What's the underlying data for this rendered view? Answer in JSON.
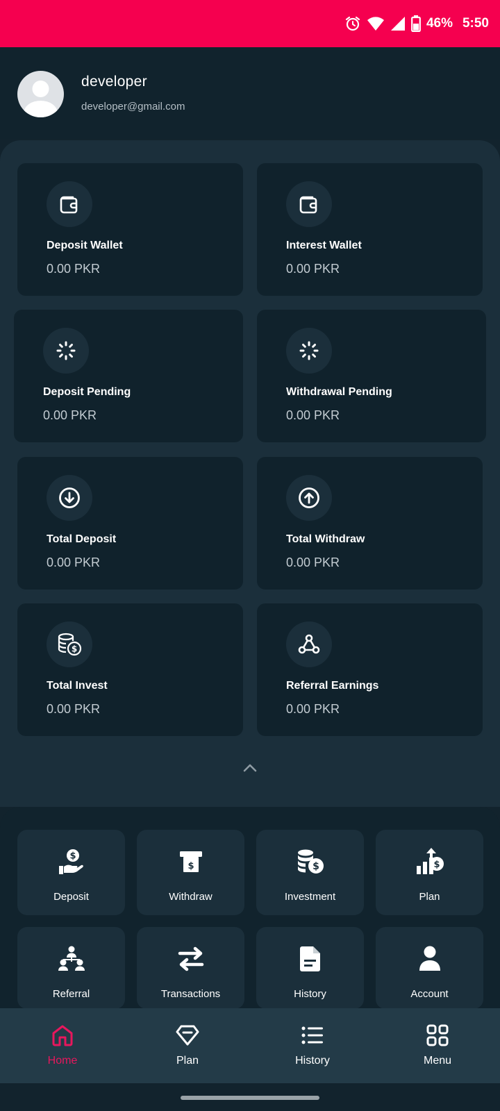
{
  "status_bar": {
    "battery": "46%",
    "time": "5:50",
    "icons": [
      "alarm-icon",
      "wifi-icon",
      "signal-icon",
      "battery-icon"
    ]
  },
  "profile": {
    "name": "developer",
    "email": "developer@gmail.com",
    "avatar_icon": "user-avatar-icon"
  },
  "stats": [
    {
      "title": "Deposit Wallet",
      "value": "0.00 PKR",
      "icon": "wallet-icon"
    },
    {
      "title": "Interest Wallet",
      "value": "0.00 PKR",
      "icon": "wallet-icon"
    },
    {
      "title": "Deposit Pending",
      "value": "0.00 PKR",
      "icon": "spinner-icon"
    },
    {
      "title": "Withdrawal Pending",
      "value": "0.00 PKR",
      "icon": "spinner-icon"
    },
    {
      "title": "Total Deposit",
      "value": "0.00 PKR",
      "icon": "arrow-down-circle-icon"
    },
    {
      "title": "Total Withdraw",
      "value": "0.00 PKR",
      "icon": "arrow-up-circle-icon"
    },
    {
      "title": "Total Invest",
      "value": "0.00 PKR",
      "icon": "coins-dollar-icon"
    },
    {
      "title": "Referral Earnings",
      "value": "0.00 PKR",
      "icon": "network-icon"
    }
  ],
  "menu": [
    {
      "label": "Deposit",
      "icon": "hand-dollar-icon"
    },
    {
      "label": "Withdraw",
      "icon": "atm-icon"
    },
    {
      "label": "Investment",
      "icon": "coins-dollar-icon"
    },
    {
      "label": "Plan",
      "icon": "growth-chart-icon"
    },
    {
      "label": "Referral",
      "icon": "team-icon"
    },
    {
      "label": "Transactions",
      "icon": "exchange-icon"
    },
    {
      "label": "History",
      "icon": "document-icon"
    },
    {
      "label": "Account",
      "icon": "user-icon"
    }
  ],
  "bottom_nav": [
    {
      "label": "Home",
      "icon": "home-icon",
      "active": true
    },
    {
      "label": "Plan",
      "icon": "diamond-icon",
      "active": false
    },
    {
      "label": "History",
      "icon": "list-icon",
      "active": false
    },
    {
      "label": "Menu",
      "icon": "grid-icon",
      "active": false
    }
  ],
  "colors": {
    "status_bar": "#f5004f",
    "background": "#12232d",
    "panel": "#1b2f3b",
    "card": "#10222c",
    "nav_bar": "#233b48",
    "accent": "#e8175d"
  }
}
